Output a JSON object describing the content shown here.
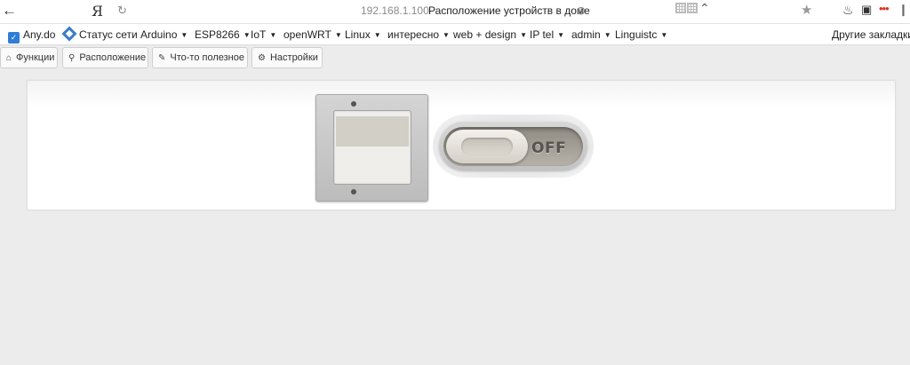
{
  "address_bar": {
    "back_glyph": "←",
    "logo": "Я",
    "reload_glyph": "↻",
    "host": "192.168.1.100",
    "page_title": "Расположение устройств в доме",
    "star_glyph": "★"
  },
  "bookmarks": [
    {
      "label": "Any.do",
      "icon": "anydo-icon",
      "dropdown": false
    },
    {
      "label": "Статус сети",
      "icon": "network-icon",
      "dropdown": false
    },
    {
      "label": "Arduino",
      "dropdown": true
    },
    {
      "label": "ESP8266",
      "dropdown": true
    },
    {
      "label": "IoT",
      "dropdown": true
    },
    {
      "label": "openWRT",
      "dropdown": true
    },
    {
      "label": "Linux",
      "dropdown": true
    },
    {
      "label": "интересно",
      "dropdown": true
    },
    {
      "label": "web + design",
      "dropdown": true
    },
    {
      "label": "IP tel",
      "dropdown": true
    },
    {
      "label": "admin",
      "dropdown": true
    },
    {
      "label": "Linguistc",
      "dropdown": true
    }
  ],
  "other_bookmarks": "Другие закладки",
  "nav": {
    "functions": {
      "label": "Функции",
      "icon": "home-icon"
    },
    "location": {
      "label": "Расположение",
      "icon": "map-marker-icon"
    },
    "useful": {
      "label": "Что-то полезное",
      "icon": "pencil-icon"
    },
    "settings": {
      "label": "Настройки",
      "icon": "gear-icon"
    }
  },
  "device": {
    "toggle_state": "OFF"
  },
  "colors": {
    "page_bg": "#ececec",
    "panel_bg": "#ffffff",
    "anydo_blue": "#2e7cd6"
  }
}
